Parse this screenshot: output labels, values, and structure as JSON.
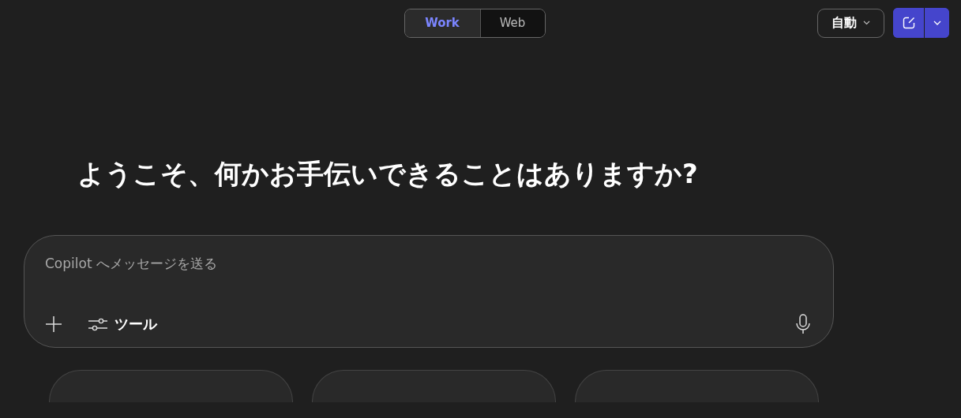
{
  "mode_tabs": [
    {
      "label": "Work",
      "selected": true
    },
    {
      "label": "Web",
      "selected": false
    }
  ],
  "model_picker": {
    "label": "自動"
  },
  "heading": "ようこそ、何かお手伝いできることはありますか?",
  "composer": {
    "placeholder": "Copilot へメッセージを送る",
    "tools_label": "ツール"
  }
}
